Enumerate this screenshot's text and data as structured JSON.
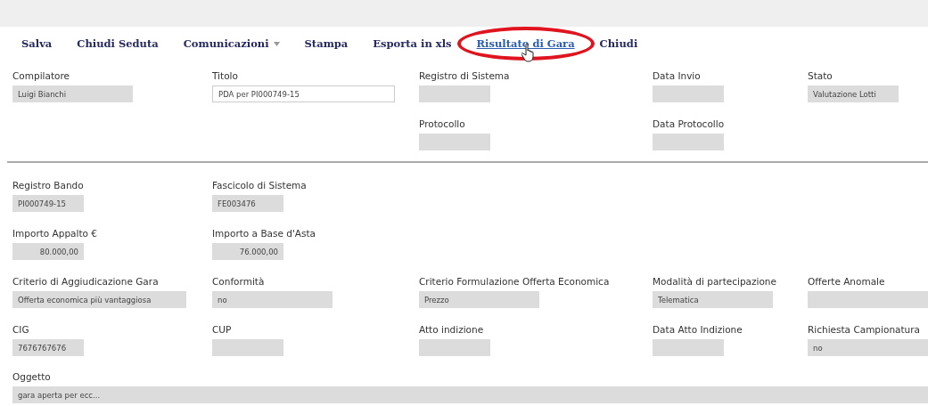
{
  "toolbar": [
    {
      "label": "Salva",
      "kind": "button",
      "selected": false
    },
    {
      "label": "Chiudi Seduta",
      "kind": "button",
      "selected": false
    },
    {
      "label": "Comunicazioni",
      "kind": "menu",
      "selected": false
    },
    {
      "label": "Stampa",
      "kind": "button",
      "selected": false
    },
    {
      "label": "Esporta in xls",
      "kind": "button",
      "selected": false
    },
    {
      "label": "Risultato di Gara",
      "kind": "button",
      "selected": true
    },
    {
      "label": "Chiudi",
      "kind": "button",
      "selected": false
    }
  ],
  "header_rows": [
    [
      {
        "label": "Compilatore",
        "value": "Luigi Bianchi",
        "kind": "medium"
      },
      {
        "label": "Titolo",
        "value": "PDA per PI000749-15",
        "kind": "input"
      },
      {
        "label": "Registro di Sistema",
        "kind": "short"
      },
      {
        "label": "Data Invio",
        "kind": "short"
      },
      {
        "label": "Stato",
        "value": "Valutazione Lotti",
        "kind": "status"
      }
    ],
    [
      null,
      null,
      {
        "label": "Protocollo",
        "kind": "short"
      },
      {
        "label": "Data Protocollo",
        "kind": "short"
      },
      null
    ]
  ],
  "detail_rows": [
    [
      {
        "label": "Registro Bando",
        "value": "PI000749-15",
        "kind": "short"
      },
      {
        "label": "Fascicolo di Sistema",
        "value": "FE003476",
        "kind": "short"
      },
      null,
      null,
      null
    ],
    [
      {
        "label": "Importo Appalto €",
        "value": "80.000,00",
        "kind": "amount"
      },
      {
        "label": "Importo a Base d'Asta",
        "value": "76.000,00",
        "kind": "amount"
      },
      null,
      null,
      null
    ],
    [
      {
        "label": "Criterio di Aggiudicazione Gara",
        "value": "Offerta economica più vantaggiosa",
        "kind": "wide"
      },
      {
        "label": "Conformità",
        "value": "no",
        "kind": "medium"
      },
      {
        "label": "Criterio Formulazione Offerta Economica",
        "value": "Prezzo",
        "kind": "medium"
      },
      {
        "label": "Modalità di partecipazione",
        "value": "Telematica",
        "kind": "medium"
      },
      {
        "label": "Offerte Anomale",
        "kind": "fill"
      }
    ],
    [
      {
        "label": "CIG",
        "value": "7676767676",
        "kind": "short"
      },
      {
        "label": "CUP",
        "kind": "short"
      },
      {
        "label": "Atto indizione",
        "kind": "short"
      },
      {
        "label": "Data Atto Indizione",
        "kind": "short"
      },
      {
        "label": "Richiesta Campionatura",
        "value": "no",
        "kind": "fill"
      }
    ]
  ],
  "oggetto": {
    "label": "Oggetto",
    "value": "gara aperta per ecc..."
  }
}
